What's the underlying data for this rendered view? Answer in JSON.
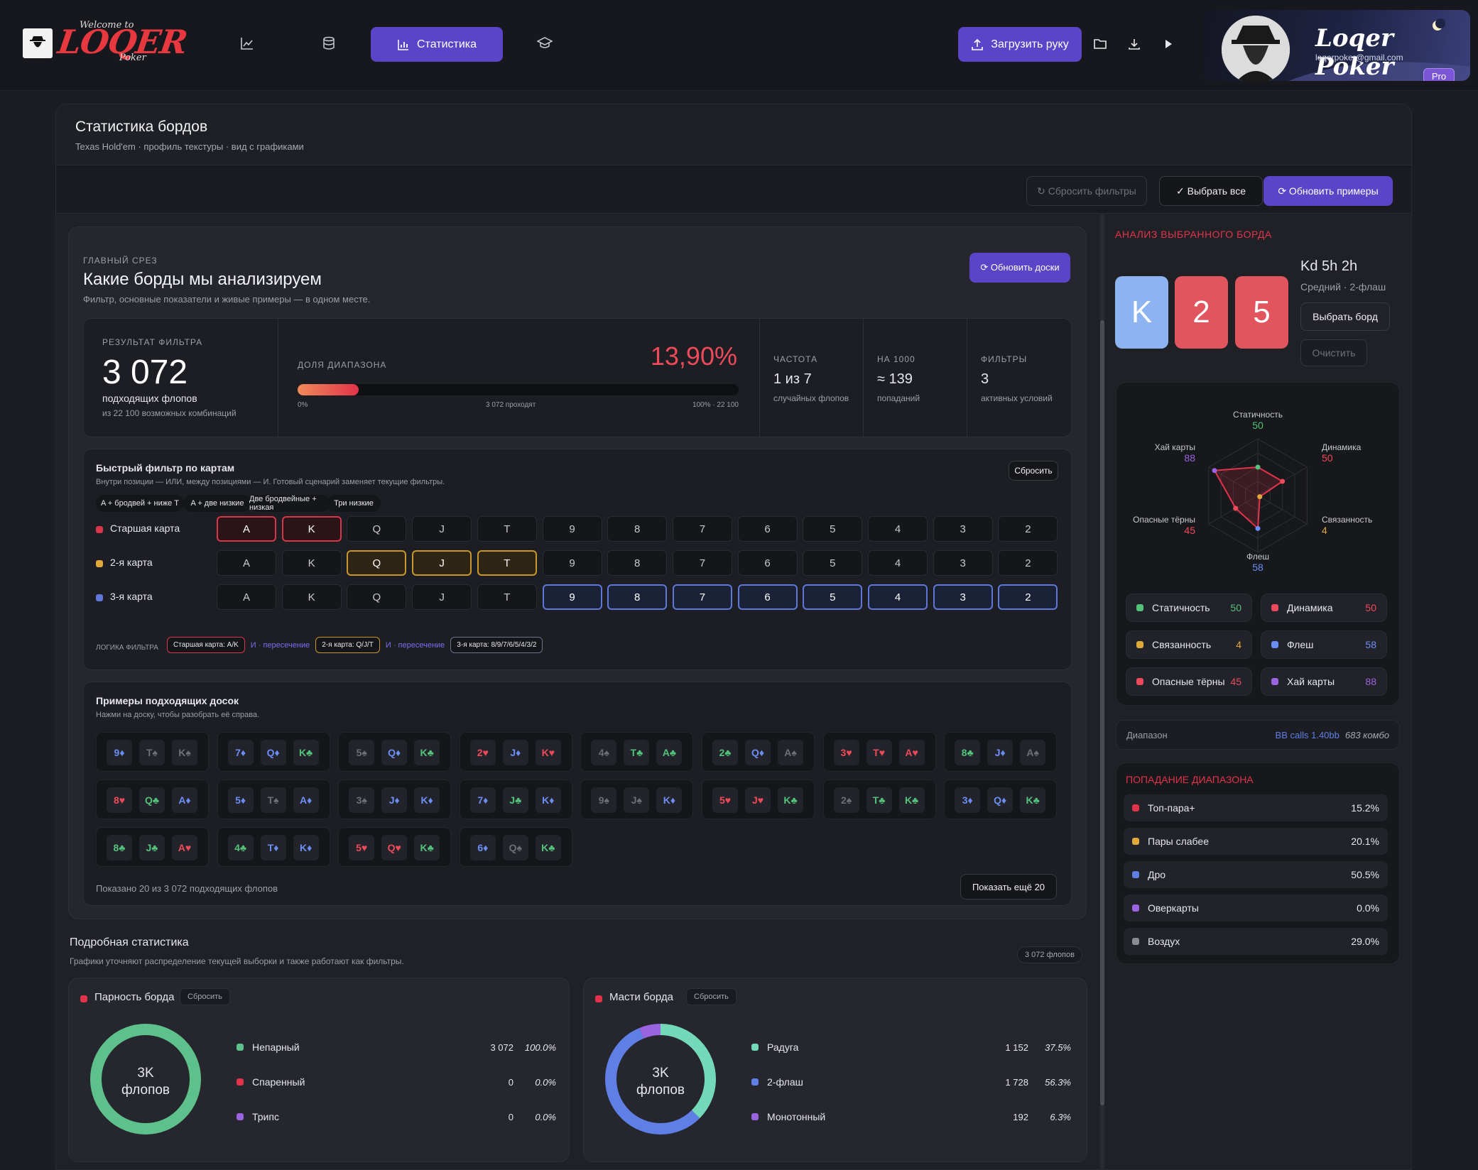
{
  "header": {
    "logo_main": "LOQER",
    "logo_top": "Welcome to",
    "logo_bottom": "Poker",
    "nav": [
      {
        "icon": "line-chart-icon"
      },
      {
        "icon": "database-icon"
      },
      {
        "icon": "bar-chart-icon",
        "label": "Статистика",
        "active": true
      },
      {
        "icon": "graduation-cap-icon"
      }
    ],
    "upload_label": "Загрузить руку",
    "icons": [
      "folder-icon",
      "download-icon",
      "play-icon"
    ],
    "profile": {
      "name": "Loqer Poker",
      "email": "loqerpoker@gmail.com",
      "badge": "Pro"
    }
  },
  "page": {
    "title": "Статистика бордов",
    "subtitle": "Texas Hold'em · профиль текстуры · вид с графиками"
  },
  "toolbar": {
    "reset_filters": "↻ Сбросить фильтры",
    "select_all": "✓ Выбрать все",
    "refresh_examples": "⟳ Обновить примеры"
  },
  "main_slice": {
    "eyebrow": "ГЛАВНЫЙ СРЕЗ",
    "title": "Какие борды мы анализируем",
    "subtitle": "Фильтр, основные показатели и живые примеры — в одном месте.",
    "refresh_boards": "⟳ Обновить доски"
  },
  "filter_result": {
    "label": "РЕЗУЛЬТАТ ФИЛЬТРА",
    "value": "3 072",
    "caption": "подходящих флопов",
    "sub": "из 22 100 возможных комбинаций",
    "range_label": "ДОЛЯ ДИАПАЗОНА",
    "range_pct": "13,90%",
    "range_fraction": 0.139,
    "scale_left": "0%",
    "scale_mid": "3 072 проходят",
    "scale_right": "100% · 22 100",
    "stats": [
      {
        "label": "ЧАСТОТА",
        "value": "1 из 7",
        "sub": "случайных флопов"
      },
      {
        "label": "НА 1000",
        "value": "≈ 139",
        "sub": "попаданий"
      },
      {
        "label": "ФИЛЬТРЫ",
        "value": "3",
        "sub": "активных условий"
      }
    ]
  },
  "quick_filter": {
    "title": "Быстрый фильтр по картам",
    "subtitle": "Внутри позиции — ИЛИ, между позициями — И. Готовый сценарий заменяет текущие фильтры.",
    "reset": "Сбросить",
    "presets": [
      "A + бродвей + ниже T",
      "A + две низкие",
      "Две бродвейные + низкая",
      "Три низкие"
    ],
    "ranks": [
      "A",
      "K",
      "Q",
      "J",
      "T",
      "9",
      "8",
      "7",
      "6",
      "5",
      "4",
      "3",
      "2"
    ],
    "rows": [
      {
        "label": "Старшая карта",
        "color": "#d9364a",
        "selected": [
          "A",
          "K"
        ]
      },
      {
        "label": "2-я карта",
        "color": "#e0a93a",
        "selected": [
          "Q",
          "J",
          "T"
        ]
      },
      {
        "label": "3-я карта",
        "color": "#5d78d9",
        "selected": [
          "9",
          "8",
          "7",
          "6",
          "5",
          "4",
          "3",
          "2"
        ]
      }
    ],
    "logic_label": "ЛОГИКА ФИЛЬТРА",
    "logic": [
      {
        "text": "Старшая карта: A/K",
        "kind": "chip-red"
      },
      {
        "text": "И · пересечение",
        "kind": "op"
      },
      {
        "text": "2-я карта: Q/J/T",
        "kind": "chip-yel"
      },
      {
        "text": "И · пересечение",
        "kind": "op"
      },
      {
        "text": "3-я карта: 8/9/7/6/5/4/3/2",
        "kind": "chip-blu"
      }
    ]
  },
  "examples": {
    "title": "Примеры подходящих досок",
    "subtitle": "Нажми на доску, чтобы разобрать её справа.",
    "boards": [
      [
        [
          "9♦",
          "blu"
        ],
        [
          "T♠",
          "gry"
        ],
        [
          "K♠",
          "gry"
        ]
      ],
      [
        [
          "7♦",
          "blu"
        ],
        [
          "Q♦",
          "blu"
        ],
        [
          "K♣",
          "grn"
        ]
      ],
      [
        [
          "5♠",
          "gry"
        ],
        [
          "Q♦",
          "blu"
        ],
        [
          "K♣",
          "grn"
        ]
      ],
      [
        [
          "2♥",
          "red"
        ],
        [
          "J♦",
          "blu"
        ],
        [
          "K♥",
          "red"
        ]
      ],
      [
        [
          "4♠",
          "gry"
        ],
        [
          "T♣",
          "grn"
        ],
        [
          "A♣",
          "grn"
        ]
      ],
      [
        [
          "2♣",
          "grn"
        ],
        [
          "Q♦",
          "blu"
        ],
        [
          "A♠",
          "gry"
        ]
      ],
      [
        [
          "3♥",
          "red"
        ],
        [
          "T♥",
          "red"
        ],
        [
          "A♥",
          "red"
        ]
      ],
      [
        [
          "8♣",
          "grn"
        ],
        [
          "J♦",
          "blu"
        ],
        [
          "A♠",
          "gry"
        ]
      ],
      [
        [
          "8♥",
          "red"
        ],
        [
          "Q♣",
          "grn"
        ],
        [
          "A♦",
          "blu"
        ]
      ],
      [
        [
          "5♦",
          "blu"
        ],
        [
          "T♠",
          "gry"
        ],
        [
          "A♦",
          "blu"
        ]
      ],
      [
        [
          "3♠",
          "gry"
        ],
        [
          "J♦",
          "blu"
        ],
        [
          "K♦",
          "blu"
        ]
      ],
      [
        [
          "7♦",
          "blu"
        ],
        [
          "J♣",
          "grn"
        ],
        [
          "K♦",
          "blu"
        ]
      ],
      [
        [
          "9♠",
          "gry"
        ],
        [
          "J♠",
          "gry"
        ],
        [
          "K♦",
          "blu"
        ]
      ],
      [
        [
          "5♥",
          "red"
        ],
        [
          "J♥",
          "red"
        ],
        [
          "K♣",
          "grn"
        ]
      ],
      [
        [
          "2♠",
          "gry"
        ],
        [
          "T♣",
          "grn"
        ],
        [
          "K♣",
          "grn"
        ]
      ],
      [
        [
          "3♦",
          "blu"
        ],
        [
          "Q♦",
          "blu"
        ],
        [
          "K♣",
          "grn"
        ]
      ],
      [
        [
          "8♣",
          "grn"
        ],
        [
          "J♣",
          "grn"
        ],
        [
          "A♥",
          "red"
        ]
      ],
      [
        [
          "4♣",
          "grn"
        ],
        [
          "T♦",
          "blu"
        ],
        [
          "K♦",
          "blu"
        ]
      ],
      [
        [
          "5♥",
          "red"
        ],
        [
          "Q♥",
          "red"
        ],
        [
          "K♣",
          "grn"
        ]
      ],
      [
        [
          "6♦",
          "blu"
        ],
        [
          "Q♠",
          "gry"
        ],
        [
          "K♣",
          "grn"
        ]
      ]
    ],
    "shown": "Показано 20 из 3 072 подходящих флопов",
    "more": "Показать ещё 20"
  },
  "detailed": {
    "title": "Подробная статистика",
    "subtitle": "Графики уточняют распределение текущей выборки и также работают как фильтры.",
    "badge": "3 072 флопов",
    "charts": [
      {
        "title": "Парность борда",
        "reset": "Сбросить",
        "center_top": "3K",
        "center_bottom": "флопов",
        "items": [
          {
            "name": "Непарный",
            "count": "3 072",
            "pct": "100.0%",
            "value": 100.0,
            "color": "#5ec08a"
          },
          {
            "name": "Спаренный",
            "count": "0",
            "pct": "0.0%",
            "value": 0.0,
            "color": "#e2334a"
          },
          {
            "name": "Трипс",
            "count": "0",
            "pct": "0.0%",
            "value": 0.0,
            "color": "#9a63e0"
          }
        ]
      },
      {
        "title": "Масти борда",
        "reset": "Сбросить",
        "center_top": "3K",
        "center_bottom": "флопов",
        "items": [
          {
            "name": "Радуга",
            "count": "1 152",
            "pct": "37.5%",
            "value": 37.5,
            "color": "#74d9b8"
          },
          {
            "name": "2-флаш",
            "count": "1 728",
            "pct": "56.3%",
            "value": 56.3,
            "color": "#5f7fe6"
          },
          {
            "name": "Монотонный",
            "count": "192",
            "pct": "6.3%",
            "value": 6.3,
            "color": "#9a63e0"
          }
        ]
      }
    ]
  },
  "analysis": {
    "title": "АНАЛИЗ ВЫБРАННОГО БОРДА",
    "board_name": "Kd 5h 2h",
    "board_desc": "Средний · 2-флаш",
    "select_board": "Выбрать борд",
    "clear": "Очистить",
    "cards": [
      {
        "rank": "K",
        "bg": "#8db4f0"
      },
      {
        "rank": "2",
        "bg": "#e2555f"
      },
      {
        "rank": "5",
        "bg": "#e2555f"
      }
    ],
    "radar": [
      {
        "name": "Статичность",
        "value": 50,
        "color": "#52c27a"
      },
      {
        "name": "Динамика",
        "value": 50,
        "color": "#ef4a5a"
      },
      {
        "name": "Связанность",
        "value": 4,
        "color": "#e0a93a"
      },
      {
        "name": "Флеш",
        "value": 58,
        "color": "#6b8ef5"
      },
      {
        "name": "Опасные тёрны",
        "value": 45,
        "color": "#ef4a5a"
      },
      {
        "name": "Хай карты",
        "value": 88,
        "color": "#9a63e0"
      }
    ],
    "range_label": "Диапазон",
    "range_value": "BB calls 1.40bb",
    "range_combos": "683 комбо"
  },
  "range_hit": {
    "title": "ПОПАДАНИЕ ДИАПАЗОНА",
    "rows": [
      {
        "name": "Топ-пара+",
        "value": "15.2%",
        "color": "#e2334a"
      },
      {
        "name": "Пары слабее",
        "value": "20.1%",
        "color": "#e0a93a"
      },
      {
        "name": "Дро",
        "value": "50.5%",
        "color": "#5f7fe6"
      },
      {
        "name": "Оверкарты",
        "value": "0.0%",
        "color": "#9a63e0"
      },
      {
        "name": "Воздух",
        "value": "29.0%",
        "color": "#8a8c94"
      }
    ]
  }
}
